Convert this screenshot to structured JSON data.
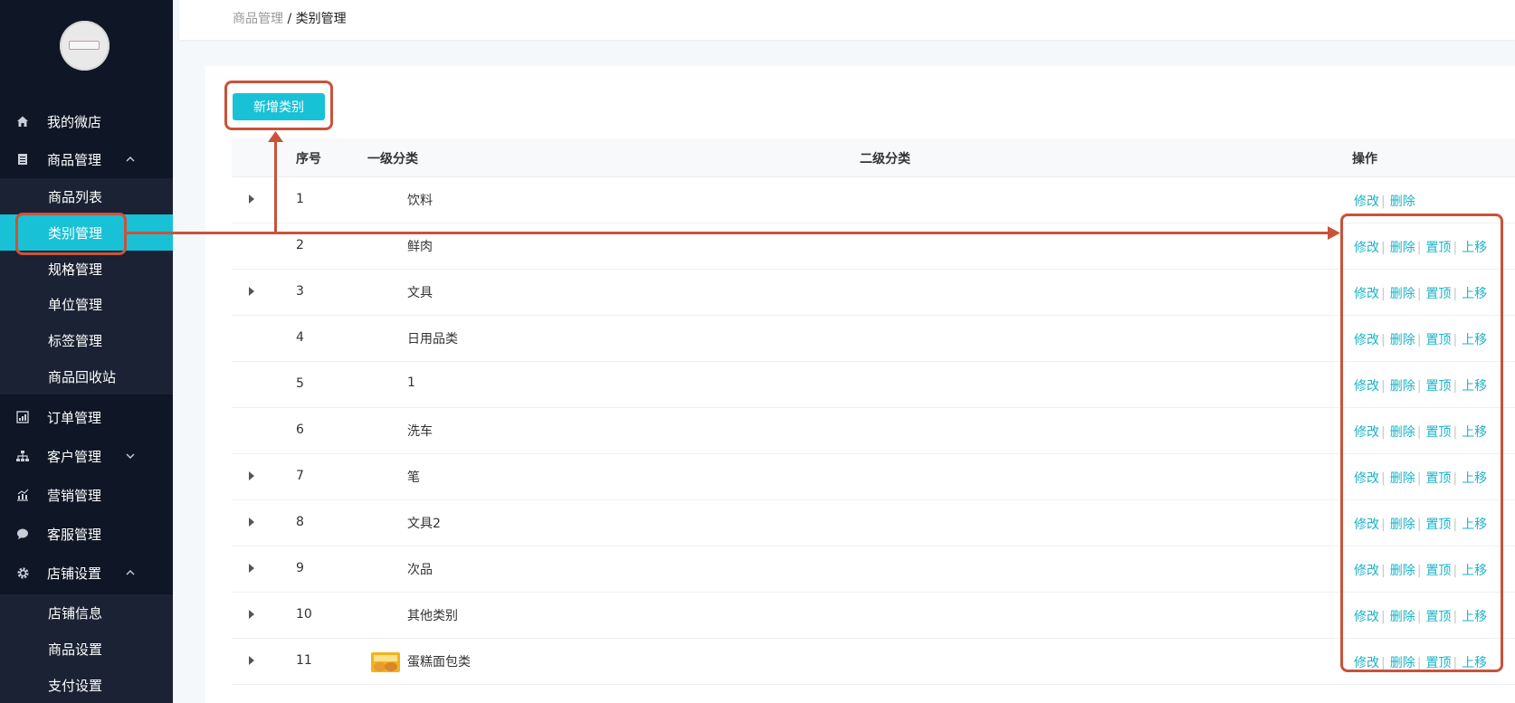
{
  "sidebar": {
    "items": [
      {
        "label": "我的微店",
        "icon": "home-icon"
      },
      {
        "label": "商品管理",
        "icon": "document-icon",
        "chevron": "^"
      },
      {
        "label": "订单管理",
        "icon": "bar-chart-icon"
      },
      {
        "label": "客户管理",
        "icon": "org-chart-icon",
        "chevron": "v"
      },
      {
        "label": "营销管理",
        "icon": "trend-chart-icon"
      },
      {
        "label": "客服管理",
        "icon": "chat-bubble-icon"
      },
      {
        "label": "店铺设置",
        "icon": "gear-icon",
        "chevron": "^"
      }
    ],
    "goods_sub": [
      "商品列表",
      "类别管理",
      "规格管理",
      "单位管理",
      "标签管理",
      "商品回收站"
    ],
    "shop_sub": [
      "店铺信息",
      "商品设置",
      "支付设置"
    ]
  },
  "breadcrumb": {
    "parent": "商品管理",
    "sep": " / ",
    "current": "类别管理"
  },
  "toolbar": {
    "add_label": "新增类别"
  },
  "table": {
    "headers": [
      "序号",
      "一级分类",
      "二级分类",
      "操作"
    ],
    "actions": [
      "修改",
      "删除",
      "置顶",
      "上移"
    ],
    "rows": [
      {
        "idx": "1",
        "name": "饮料",
        "expandable": true
      },
      {
        "idx": "2",
        "name": "鲜肉",
        "expandable": false
      },
      {
        "idx": "3",
        "name": "文具",
        "expandable": true
      },
      {
        "idx": "4",
        "name": "日用品类",
        "expandable": false
      },
      {
        "idx": "5",
        "name": "1",
        "expandable": false
      },
      {
        "idx": "6",
        "name": "洗车",
        "expandable": false
      },
      {
        "idx": "7",
        "name": "笔",
        "expandable": true
      },
      {
        "idx": "8",
        "name": "文具2",
        "expandable": true
      },
      {
        "idx": "9",
        "name": "次品",
        "expandable": true
      },
      {
        "idx": "10",
        "name": "其他类别",
        "expandable": true
      },
      {
        "idx": "11",
        "name": "蛋糕面包类",
        "expandable": true,
        "thumbnail": true
      }
    ]
  },
  "colors": {
    "sidebar_bg": "#0f1726",
    "accent": "#19c1d6",
    "link": "#1ab3c8",
    "annotation": "#c9533a"
  }
}
